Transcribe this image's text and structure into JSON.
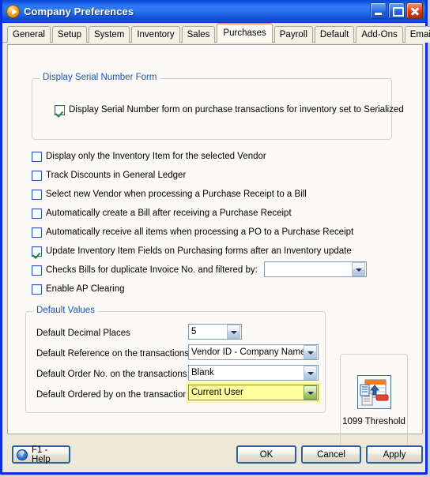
{
  "window": {
    "title": "Company Preferences",
    "app_icon": "play-circle-icon",
    "buttons": {
      "minimize": "minimize-icon",
      "maximize": "maximize-icon",
      "close": "close-icon"
    }
  },
  "tabs": [
    {
      "label": "General",
      "active": false
    },
    {
      "label": "Setup",
      "active": false
    },
    {
      "label": "System",
      "active": false
    },
    {
      "label": "Inventory",
      "active": false
    },
    {
      "label": "Sales",
      "active": false
    },
    {
      "label": "Purchases",
      "active": true
    },
    {
      "label": "Payroll",
      "active": false
    },
    {
      "label": "Default",
      "active": false
    },
    {
      "label": "Add-Ons",
      "active": false
    },
    {
      "label": "Email Setup",
      "active": false
    }
  ],
  "serial_group": {
    "legend": "Display Serial Number Form",
    "checkbox": {
      "label": "Display Serial Number form on purchase transactions for inventory set to Serialized",
      "checked": true
    }
  },
  "options": [
    {
      "label": "Display only the Inventory Item for the selected Vendor",
      "checked": false
    },
    {
      "label": "Track Discounts in General Ledger",
      "checked": false
    },
    {
      "label": "Select new Vendor when processing a Purchase Receipt to a Bill",
      "checked": false
    },
    {
      "label": "Automatically create a Bill after receiving a Purchase Receipt",
      "checked": false
    },
    {
      "label": "Automatically receive all items when processing a PO to a Purchase Receipt",
      "checked": false
    },
    {
      "label": "Update Inventory Item Fields on Purchasing forms after an Inventory update",
      "checked": true
    },
    {
      "label": "Checks Bills for duplicate Invoice No. and filtered by:",
      "checked": false,
      "combo_value": ""
    },
    {
      "label": "Enable AP Clearing",
      "checked": false
    }
  ],
  "default_values": {
    "legend": "Default Values",
    "fields": [
      {
        "label": "Default Decimal Places",
        "value": "5",
        "highlight": false
      },
      {
        "label": "Default Reference on the transactions",
        "value": "Vendor ID - Company Name",
        "highlight": false
      },
      {
        "label": "Default Order No. on the transactions",
        "value": "Blank",
        "highlight": false
      },
      {
        "label": "Default Ordered by on the transactions",
        "value": "Current User",
        "highlight": true
      }
    ]
  },
  "threshold": {
    "label": "1099 Threshold",
    "icon": "form-export-icon"
  },
  "footer": {
    "help_label": "F1 - Help",
    "help_icon": "question-circle-icon",
    "ok_label": "OK",
    "cancel_label": "Cancel",
    "apply_label": "Apply"
  },
  "colors": {
    "titlebar_blue": "#1f69ec",
    "frame_blue": "#0831d9",
    "panel_bg": "#fbfaf6",
    "legend_blue": "#1b54b8",
    "check_green": "#1d8a2b",
    "highlight_yellow": "#ffff9e",
    "active_tab_accent": "#e8a33d"
  }
}
